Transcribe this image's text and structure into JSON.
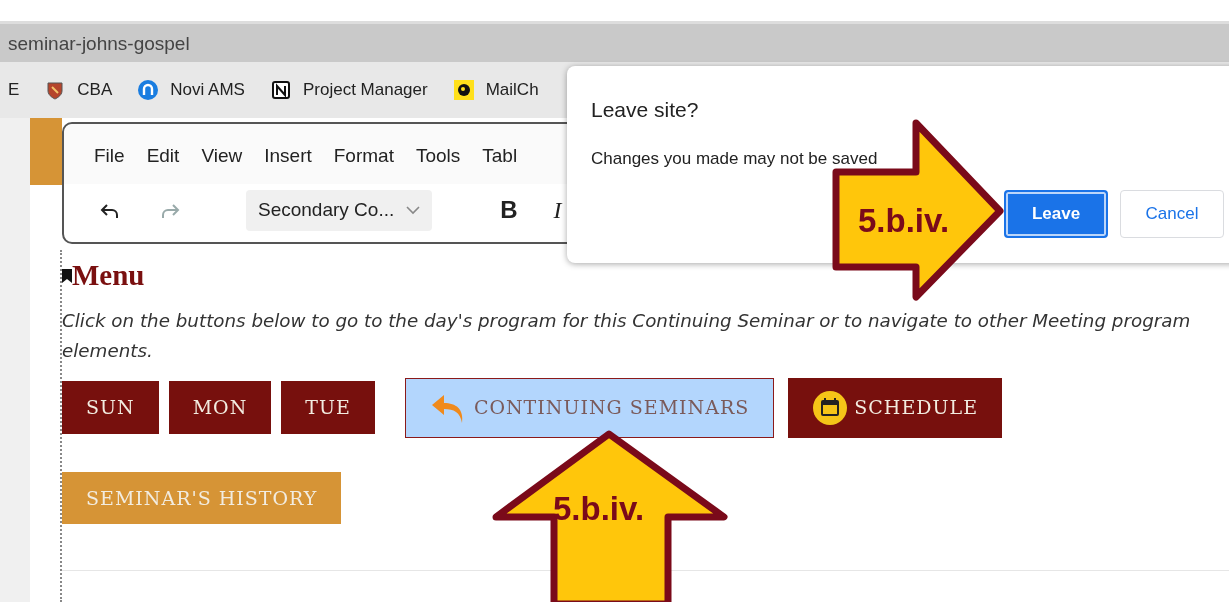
{
  "browser": {
    "address": "seminar-johns-gospel",
    "bookmarks": [
      {
        "label": "E",
        "kind": "none"
      },
      {
        "label": "CBA",
        "kind": "shield"
      },
      {
        "label": "Novi AMS",
        "kind": "circle"
      },
      {
        "label": "Project Manager",
        "kind": "notion"
      },
      {
        "label": "MailCh",
        "kind": "chimp"
      }
    ]
  },
  "editor": {
    "menu": [
      "File",
      "Edit",
      "View",
      "Insert",
      "Format",
      "Tools",
      "Tabl"
    ],
    "toolbar": [
      {
        "kind": "undo",
        "disabled": false
      },
      {
        "kind": "redo",
        "disabled": true
      },
      {
        "kind": "select",
        "value": "Secondary Co..."
      },
      {
        "kind": "bold",
        "label": "B"
      },
      {
        "kind": "italic",
        "label": "I"
      }
    ]
  },
  "content": {
    "heading": "Menu",
    "intro": "Click on the buttons below to go to the day's program for this Continuing Seminar or to navigate to other Meeting program elements.",
    "buttons": [
      {
        "label": "SUN",
        "kind": "day",
        "highlighted": false
      },
      {
        "label": "MON",
        "kind": "day",
        "highlighted": false
      },
      {
        "label": "TUE",
        "kind": "day",
        "highlighted": false
      },
      {
        "label": "CONTINUING SEMINARS",
        "kind": "back",
        "highlighted": true
      },
      {
        "label": "SCHEDULE",
        "kind": "schedule",
        "highlighted": false
      },
      {
        "label": "SEMINAR'S HISTORY",
        "kind": "history",
        "highlighted": false
      }
    ]
  },
  "dialog": {
    "title": "Leave site?",
    "message": "Changes you made may not be saved",
    "buttons": [
      {
        "label": "Leave",
        "primary": true
      },
      {
        "label": "Cancel",
        "primary": false
      }
    ]
  },
  "annotations": [
    {
      "label": "5.b.iv.",
      "kind": "right-arrow"
    },
    {
      "label": "5.b.iv.",
      "kind": "up-arrow"
    }
  ]
}
